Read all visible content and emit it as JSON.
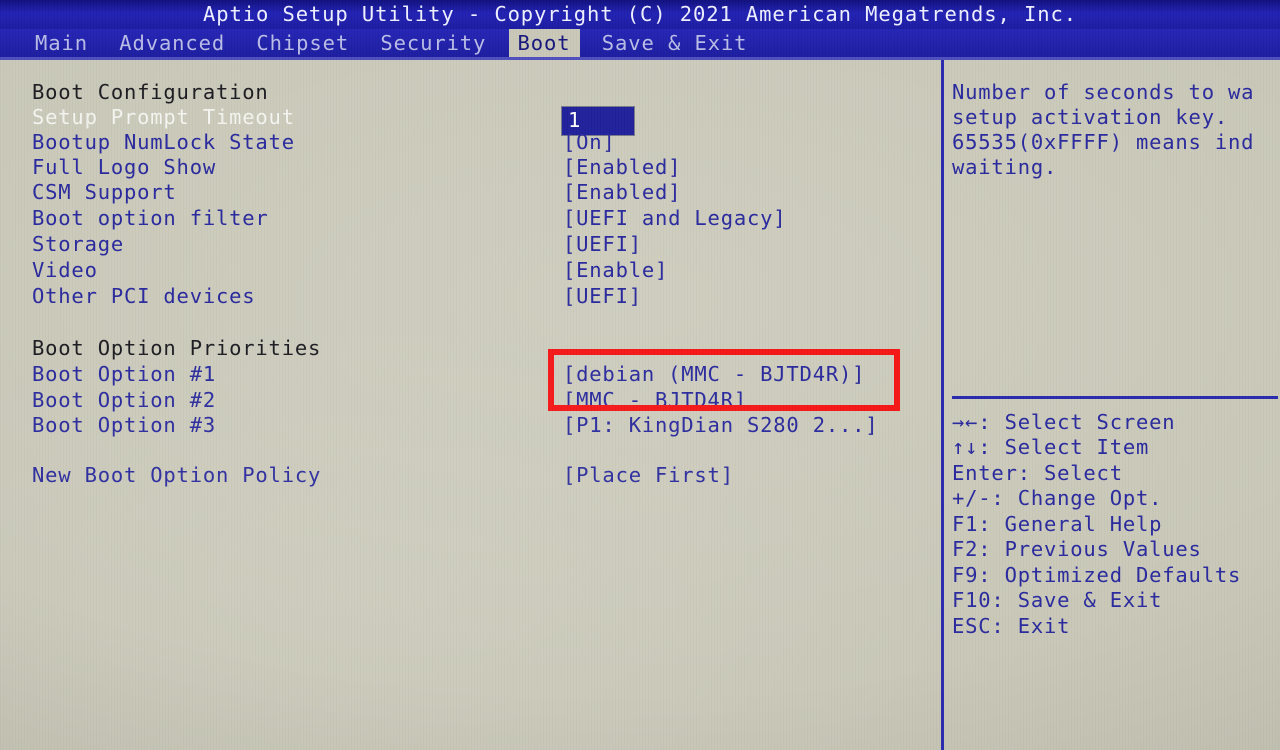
{
  "titlebar": {
    "text": "Aptio Setup Utility - Copyright (C) 2021 American Megatrends, Inc."
  },
  "menubar": {
    "items": [
      {
        "label": "Main",
        "active": false
      },
      {
        "label": "Advanced",
        "active": false
      },
      {
        "label": "Chipset",
        "active": false
      },
      {
        "label": "Security",
        "active": false
      },
      {
        "label": "Boot",
        "active": true
      },
      {
        "label": "Save & Exit",
        "active": false
      }
    ]
  },
  "colors": {
    "screen_background": "#c9c8b8",
    "title_bar_blue": "#1a1aa8",
    "text_blue": "#2a2a9e",
    "header_dark": "#1c1c22",
    "selected_white": "#f4f4f0",
    "highlight_blue": "#21219c",
    "annotation_red": "#f51717"
  },
  "main": {
    "sections": [
      {
        "header": "Boot Configuration",
        "rows": [
          {
            "label": "Setup Prompt Timeout",
            "value": "1",
            "selected": true,
            "value_highlight": true
          },
          {
            "label": "Bootup NumLock State",
            "value": "[On]",
            "selected": false,
            "value_highlight": false
          },
          {
            "label": "Full Logo Show",
            "value": "[Enabled]",
            "selected": false,
            "value_highlight": false
          },
          {
            "label": "CSM Support",
            "value": "[Enabled]",
            "selected": false,
            "value_highlight": false
          },
          {
            "label": "Boot option filter",
            "value": "[UEFI and Legacy]",
            "selected": false,
            "value_highlight": false
          },
          {
            "label": "Storage",
            "value": "[UEFI]",
            "selected": false,
            "value_highlight": false
          },
          {
            "label": "Video",
            "value": "[Enable]",
            "selected": false,
            "value_highlight": false
          },
          {
            "label": "Other PCI devices",
            "value": "[UEFI]",
            "selected": false,
            "value_highlight": false
          }
        ]
      },
      {
        "header": "Boot Option Priorities",
        "rows": [
          {
            "label": "Boot Option #1",
            "value": "[debian (MMC - BJTD4R)]",
            "selected": false,
            "value_highlight": false
          },
          {
            "label": "Boot Option #2",
            "value": "[MMC - BJTD4R]",
            "selected": false,
            "value_highlight": false
          },
          {
            "label": "Boot Option #3",
            "value": "[P1: KingDian S280 2...]",
            "selected": false,
            "value_highlight": false
          }
        ]
      }
    ],
    "policy_row": {
      "label": "New Boot Option Policy",
      "value": "[Place First]"
    }
  },
  "annotation": {
    "shape": "rectangle",
    "color": "#f51717",
    "covers": [
      "Boot Option #1 value",
      "Boot Option #2 value"
    ]
  },
  "help": {
    "lines": [
      "Number of seconds to wa",
      "setup activation key.",
      "65535(0xFFFF) means ind",
      "waiting."
    ]
  },
  "legend": {
    "lines": [
      "→←: Select Screen",
      "↑↓: Select Item",
      "Enter: Select",
      "+/-: Change Opt.",
      "F1: General Help",
      "F2: Previous Values",
      "F9: Optimized Defaults",
      "F10: Save & Exit",
      "ESC: Exit"
    ]
  }
}
